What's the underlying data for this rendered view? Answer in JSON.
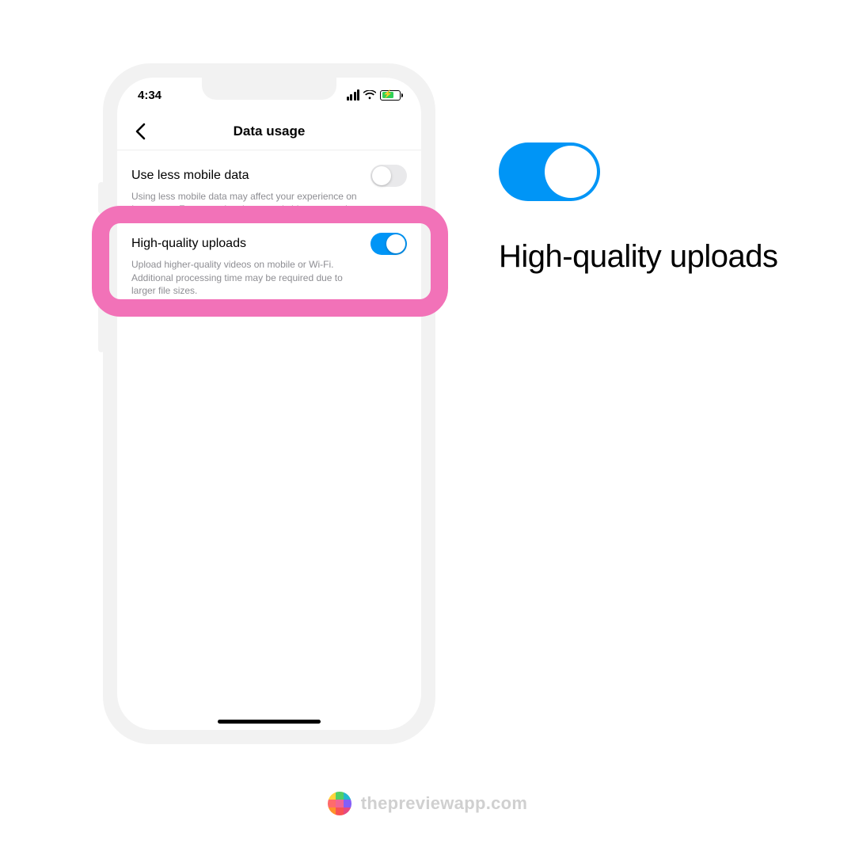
{
  "status": {
    "time": "4:34"
  },
  "nav": {
    "title": "Data usage"
  },
  "settings": {
    "use_less": {
      "title": "Use less mobile data",
      "desc": "Using less mobile data may affect your experience on Instagram. For example, photos and videos may take"
    },
    "hq": {
      "title": "High-quality uploads",
      "desc": "Upload higher-quality videos on mobile or Wi-Fi. Additional processing time may be required due to larger file sizes."
    }
  },
  "callout": {
    "label": "High-quality uploads"
  },
  "footer": {
    "text": "thepreviewapp.com"
  }
}
